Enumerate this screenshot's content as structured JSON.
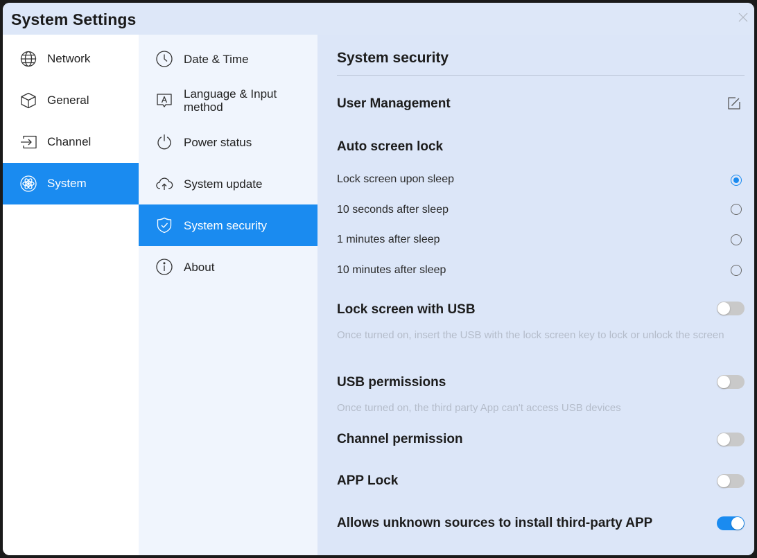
{
  "window": {
    "title": "System Settings"
  },
  "sidebar": {
    "items": [
      {
        "label": "Network",
        "icon": "globe-icon"
      },
      {
        "label": "General",
        "icon": "cube-icon"
      },
      {
        "label": "Channel",
        "icon": "input-source-icon"
      },
      {
        "label": "System",
        "icon": "atom-icon",
        "active": true
      }
    ]
  },
  "submenu": {
    "items": [
      {
        "label": "Date & Time",
        "icon": "clock-icon"
      },
      {
        "label": "Language & Input method",
        "icon": "keyboard-letter-icon"
      },
      {
        "label": "Power status",
        "icon": "power-icon"
      },
      {
        "label": "System update",
        "icon": "cloud-upload-icon"
      },
      {
        "label": "System security",
        "icon": "shield-check-icon",
        "active": true
      },
      {
        "label": "About",
        "icon": "info-icon"
      }
    ]
  },
  "content": {
    "title": "System security",
    "user_management": "User Management",
    "auto_lock": {
      "title": "Auto screen lock",
      "options": [
        {
          "label": "Lock screen upon sleep",
          "selected": true
        },
        {
          "label": "10 seconds after sleep",
          "selected": false
        },
        {
          "label": "1 minutes after sleep",
          "selected": false
        },
        {
          "label": "10 minutes after sleep",
          "selected": false
        }
      ]
    },
    "usb_lock": {
      "label": "Lock screen with USB",
      "desc": "Once turned on, insert the USB with the lock screen key to lock or unlock the screen",
      "on": false
    },
    "usb_permissions": {
      "label": "USB permissions",
      "desc": "Once turned on, the third party App can't access USB devices",
      "on": false
    },
    "channel_permission": {
      "label": "Channel permission",
      "on": false
    },
    "app_lock": {
      "label": "APP Lock",
      "on": false
    },
    "unknown_sources": {
      "label": "Allows unknown sources to install third-party APP",
      "on": true
    }
  },
  "colors": {
    "accent": "#1a8bf0",
    "titlebar": "#dde7f8",
    "content_bg": "#dce6f8",
    "submenu_bg": "#f0f5fd"
  }
}
